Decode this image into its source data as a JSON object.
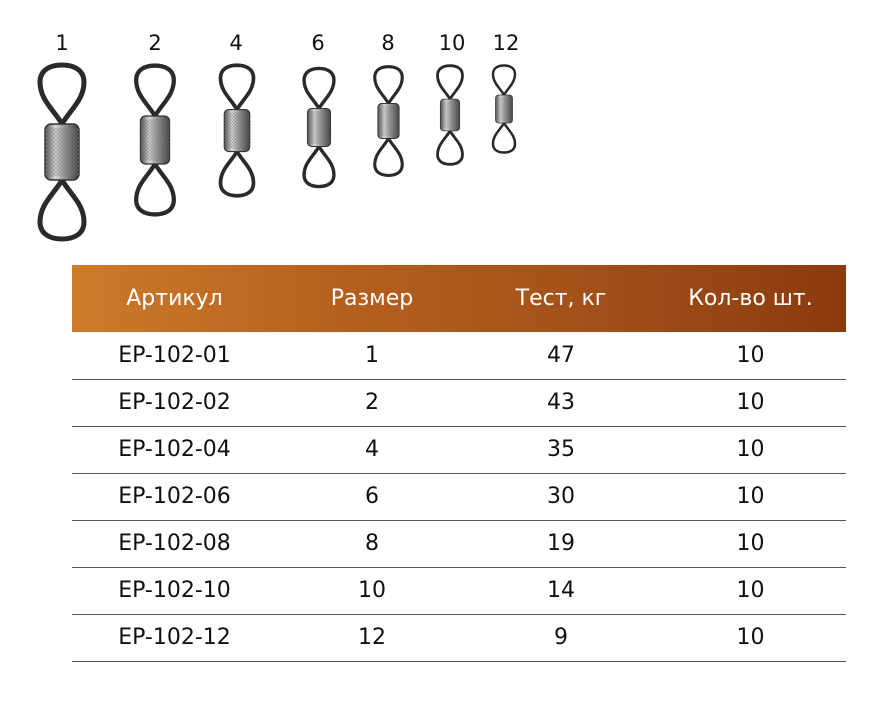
{
  "swivel_sizes": [
    "1",
    "2",
    "4",
    "6",
    "8",
    "10",
    "12"
  ],
  "table": {
    "headers": [
      "Артикул",
      "Размер",
      "Тест, кг",
      "Кол-во шт."
    ],
    "rows": [
      [
        "EP-102-01",
        "1",
        "47",
        "10"
      ],
      [
        "EP-102-02",
        "2",
        "43",
        "10"
      ],
      [
        "EP-102-04",
        "4",
        "35",
        "10"
      ],
      [
        "EP-102-06",
        "6",
        "30",
        "10"
      ],
      [
        "EP-102-08",
        "8",
        "19",
        "10"
      ],
      [
        "EP-102-10",
        "10",
        "14",
        "10"
      ],
      [
        "EP-102-12",
        "12",
        "9",
        "10"
      ]
    ]
  },
  "colors": {
    "header_start": "#cd7a2c",
    "header_end": "#8a3a0e"
  }
}
